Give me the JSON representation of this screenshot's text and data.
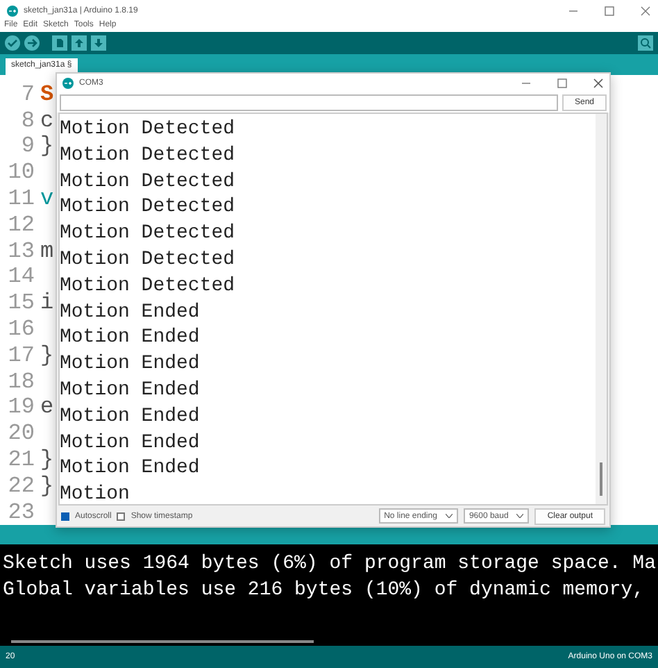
{
  "window": {
    "title": "sketch_jan31a | Arduino 1.8.19"
  },
  "menu": [
    "File",
    "Edit",
    "Sketch",
    "Tools",
    "Help"
  ],
  "tabs": [
    {
      "label": "sketch_jan31a §",
      "selected": true
    }
  ],
  "editor": {
    "lines": [
      {
        "number": "7",
        "code": "S",
        "kind": "keyword"
      },
      {
        "number": "8",
        "code": "c",
        "kind": "plain"
      },
      {
        "number": "9",
        "code": "}",
        "kind": "plain"
      },
      {
        "number": "10"
      },
      {
        "number": "11",
        "code": "v",
        "kind": "type"
      },
      {
        "number": "12"
      },
      {
        "number": "13",
        "code": "m",
        "kind": "plain"
      },
      {
        "number": "14"
      },
      {
        "number": "15",
        "code": "i",
        "kind": "plain"
      },
      {
        "number": "16"
      },
      {
        "number": "17",
        "code": "}",
        "kind": "plain"
      },
      {
        "number": "18"
      },
      {
        "number": "19",
        "code": "e",
        "kind": "plain"
      },
      {
        "number": "20"
      },
      {
        "number": "21",
        "code": "}",
        "kind": "plain"
      },
      {
        "number": "22",
        "code": "}",
        "kind": "plain"
      },
      {
        "number": "23"
      }
    ]
  },
  "serial_monitor": {
    "title": "COM3",
    "send_button": "Send",
    "output": [
      "Motion Detected",
      "Motion Detected",
      "Motion Detected",
      "Motion Detected",
      "Motion Detected",
      "Motion Detected",
      "Motion Detected",
      "Motion Ended",
      "Motion Ended",
      "Motion Ended",
      "Motion Ended",
      "Motion Ended",
      "Motion Ended",
      "Motion Ended",
      "Motion"
    ],
    "autoscroll": {
      "label": "Autoscroll",
      "checked": true
    },
    "timestamp": {
      "label": "Show timestamp",
      "checked": false
    },
    "line_ending": "No line ending",
    "baud": "9600 baud",
    "clear_button": "Clear output"
  },
  "console": [
    "Sketch uses 1964 bytes (6%) of program storage space. Ma",
    "Global variables use 216 bytes (10%) of dynamic memory,"
  ],
  "status_bar": {
    "line": "20",
    "board": "Arduino Uno on COM3"
  }
}
